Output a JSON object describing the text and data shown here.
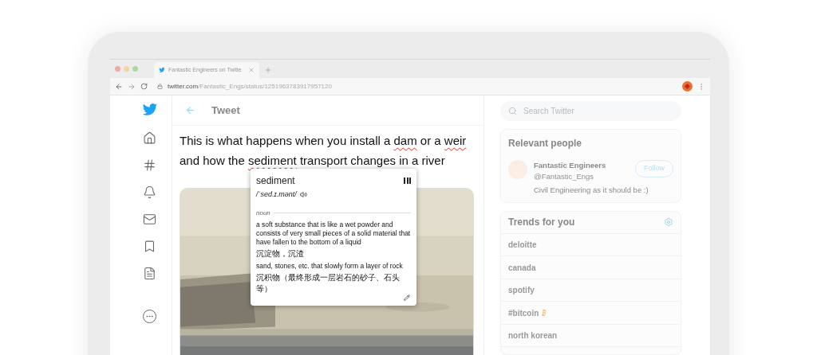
{
  "browser": {
    "tab": {
      "title": "Fantastic Engineers on Twitte"
    },
    "url_host": "twitter.com",
    "url_path": "/Fantastic_Engs/status/1251963783917957120"
  },
  "header": {
    "title": "Tweet"
  },
  "tweet": {
    "segments": [
      {
        "text": "This is what happens when you install a ",
        "flagged": false
      },
      {
        "text": "dam",
        "flagged": true
      },
      {
        "text": " or a ",
        "flagged": false
      },
      {
        "text": "weir",
        "flagged": true
      },
      {
        "text": " and how the ",
        "flagged": false
      },
      {
        "text": "sediment",
        "flagged": true
      },
      {
        "text": " transport changes in a river",
        "flagged": false
      }
    ]
  },
  "popup": {
    "word": "sediment",
    "pronunciation": "/ˈsed.ɪ.mənt/",
    "part_of_speech": "noun",
    "senses": [
      {
        "en": "a soft substance that is like a wet powder and consists of very small pieces of a solid material that have fallen to the bottom of a liquid",
        "zh": "沉淀物，沉渣"
      },
      {
        "en": "sand, stones, etc. that slowly form a layer of rock",
        "zh": "沉积物（最终形成一层岩石的砂子、石头等）"
      }
    ]
  },
  "sidebar": {
    "search": {
      "placeholder": "Search Twitter"
    },
    "relevant_people": {
      "title": "Relevant people",
      "person": {
        "name": "Fantastic Engineers",
        "handle": "@Fantastic_Engs",
        "bio": "Civil Engineering as it should be :)",
        "button": "Follow"
      }
    },
    "trends": {
      "title": "Trends for you",
      "items": [
        {
          "label": "deloitte",
          "kind": "plain"
        },
        {
          "label": "canada",
          "kind": "plain"
        },
        {
          "label": "spotify",
          "kind": "plain"
        },
        {
          "label": "#bitcoin",
          "kind": "bitcoin"
        },
        {
          "label": "north korean",
          "kind": "plain"
        }
      ]
    }
  }
}
